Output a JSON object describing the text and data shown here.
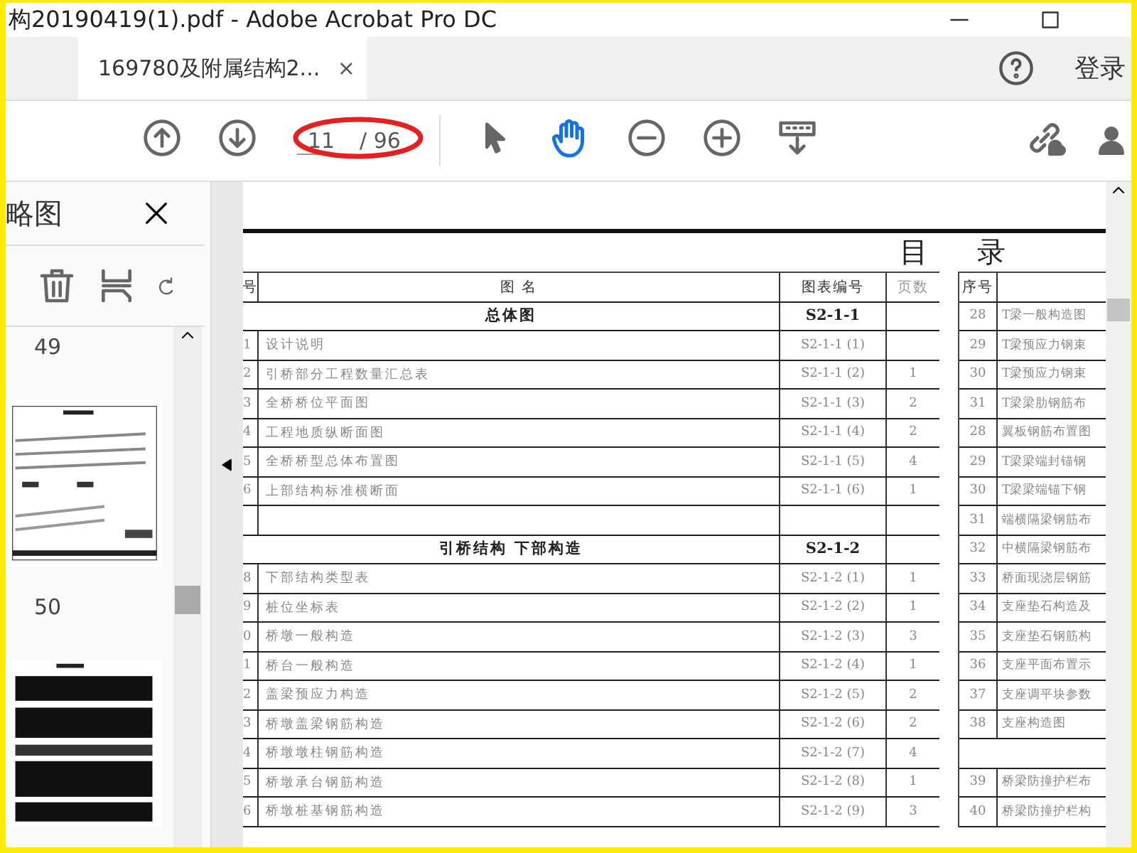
{
  "window": {
    "title": "构20190419(1).pdf - Adobe Acrobat Pro DC"
  },
  "tabs": [
    {
      "label": "169780及附属结构2...",
      "close": "×",
      "selected": true
    }
  ],
  "account": {
    "sign_in": "登录"
  },
  "toolbar": {
    "page_current": "11",
    "page_total": "/ 96",
    "tools": [
      {
        "kind": "select",
        "selected": false
      },
      {
        "kind": "hand",
        "selected": true
      }
    ]
  },
  "sidebar": {
    "title": "略图",
    "thumbnails": [
      {
        "page": "49",
        "kind": "plan"
      },
      {
        "page": "50",
        "kind": "table"
      }
    ]
  },
  "document": {
    "heading": "目 录",
    "left_table": {
      "columns": [
        "号",
        "图 名",
        "图表编号",
        "页数"
      ],
      "rows": [
        {
          "kind": "group",
          "name": "总体图",
          "code": "S2-1-1"
        },
        {
          "kind": "item",
          "no": "1",
          "name": "设计说明",
          "code": "S2-1-1 (1)"
        },
        {
          "kind": "item",
          "no": "2",
          "name": "引桥部分工程数量汇总表",
          "code": "S2-1-1 (2)",
          "pages": "1"
        },
        {
          "kind": "item",
          "no": "3",
          "name": "全桥桥位平面图",
          "code": "S2-1-1 (3)",
          "pages": "2"
        },
        {
          "kind": "item",
          "no": "4",
          "name": "工程地质纵断面图",
          "code": "S2-1-1 (4)",
          "pages": "2"
        },
        {
          "kind": "item",
          "no": "5",
          "name": "全桥桥型总体布置图",
          "code": "S2-1-1 (5)",
          "pages": "4"
        },
        {
          "kind": "item",
          "no": "6",
          "name": "上部结构标准横断面",
          "code": "S2-1-1 (6)",
          "pages": "1"
        },
        {
          "kind": "blank"
        },
        {
          "kind": "group",
          "name": "引桥结构 下部构造",
          "code": "S2-1-2"
        },
        {
          "kind": "item",
          "no": "8",
          "name": "下部结构类型表",
          "code": "S2-1-2 (1)",
          "pages": "1"
        },
        {
          "kind": "item",
          "no": "9",
          "name": "桩位坐标表",
          "code": "S2-1-2 (2)",
          "pages": "1"
        },
        {
          "kind": "item",
          "no": "0",
          "name": "桥墩一般构造",
          "code": "S2-1-2 (3)",
          "pages": "3"
        },
        {
          "kind": "item",
          "no": "1",
          "name": "桥台一般构造",
          "code": "S2-1-2 (4)",
          "pages": "1"
        },
        {
          "kind": "item",
          "no": "2",
          "name": "盖梁预应力构造",
          "code": "S2-1-2 (5)",
          "pages": "2"
        },
        {
          "kind": "item",
          "no": "3",
          "name": "桥墩盖梁钢筋构造",
          "code": "S2-1-2 (6)",
          "pages": "2"
        },
        {
          "kind": "item",
          "no": "4",
          "name": "桥墩墩柱钢筋构造",
          "code": "S2-1-2 (7)",
          "pages": "4"
        },
        {
          "kind": "item",
          "no": "5",
          "name": "桥墩承台钢筋构造",
          "code": "S2-1-2 (8)",
          "pages": "1"
        },
        {
          "kind": "item",
          "no": "6",
          "name": "桥墩桩基钢筋构造",
          "code": "S2-1-2 (9)",
          "pages": "3"
        }
      ]
    },
    "right_table": {
      "columns": [
        "序号"
      ],
      "rows": [
        {
          "kind": "item",
          "no": "28",
          "name": "T梁一般构造图"
        },
        {
          "kind": "item",
          "no": "29",
          "name": "T梁预应力钢束"
        },
        {
          "kind": "item",
          "no": "30",
          "name": "T梁预应力钢束"
        },
        {
          "kind": "item",
          "no": "31",
          "name": "T梁梁肋钢筋布"
        },
        {
          "kind": "item",
          "no": "28",
          "name": "翼板钢筋布置图"
        },
        {
          "kind": "item",
          "no": "29",
          "name": "T梁梁端封锚钢"
        },
        {
          "kind": "item",
          "no": "30",
          "name": "T梁梁端锚下钢"
        },
        {
          "kind": "item",
          "no": "31",
          "name": "端横隔梁钢筋布"
        },
        {
          "kind": "item",
          "no": "32",
          "name": "中横隔梁钢筋布"
        },
        {
          "kind": "item",
          "no": "33",
          "name": "桥面现浇层钢筋"
        },
        {
          "kind": "item",
          "no": "34",
          "name": "支座垫石构造及"
        },
        {
          "kind": "item",
          "no": "35",
          "name": "支座垫石钢筋构"
        },
        {
          "kind": "item",
          "no": "36",
          "name": "支座平面布置示"
        },
        {
          "kind": "item",
          "no": "37",
          "name": "支座调平块参数"
        },
        {
          "kind": "item",
          "no": "38",
          "name": "支座构造图"
        },
        {
          "kind": "blank"
        },
        {
          "kind": "item",
          "no": "39",
          "name": "桥梁防撞护栏布"
        },
        {
          "kind": "item",
          "no": "40",
          "name": "桥梁防撞护栏构"
        }
      ]
    }
  }
}
